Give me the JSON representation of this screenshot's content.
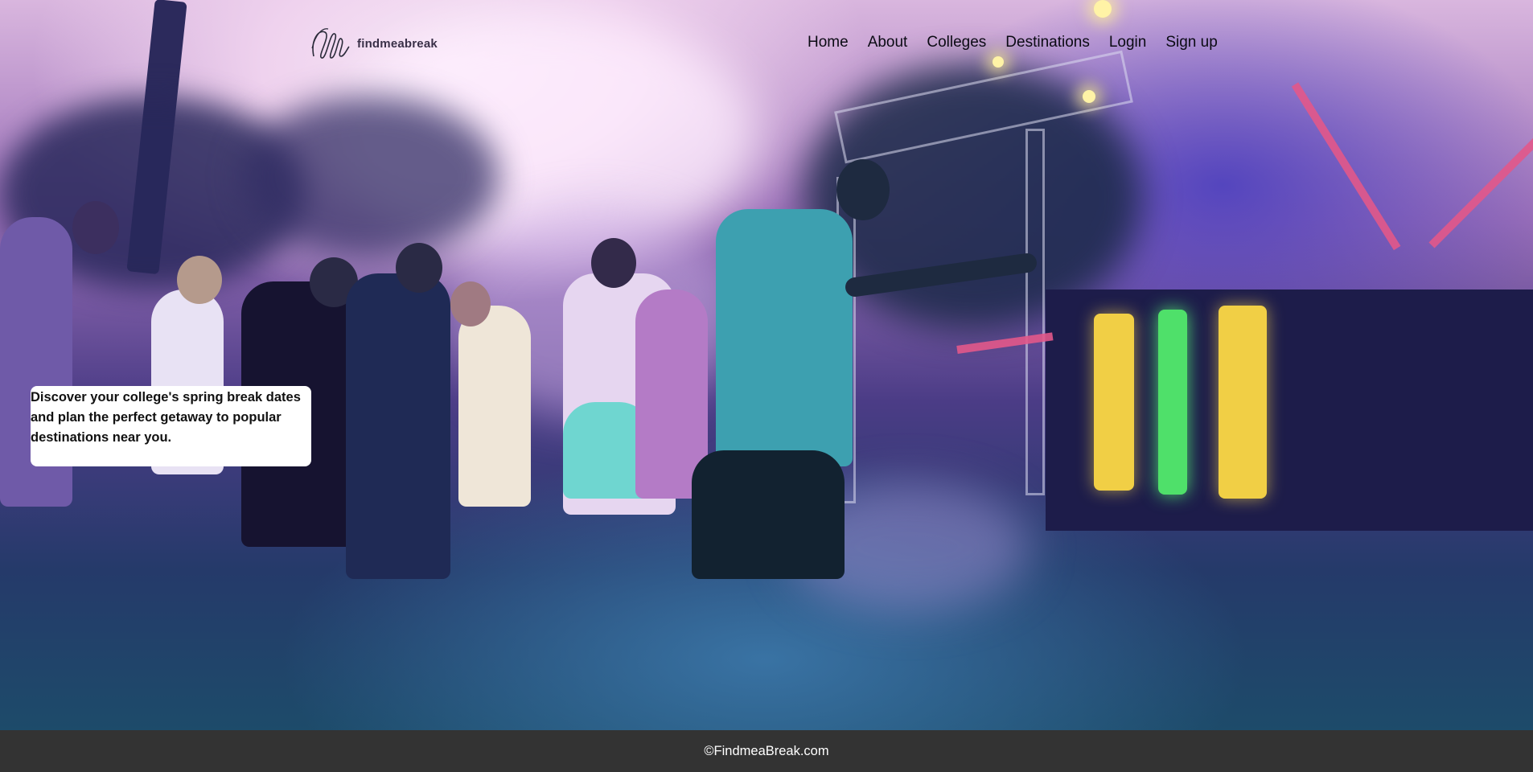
{
  "brand": {
    "name": "findmeabreak",
    "logo_icon": "scribble-logo-icon"
  },
  "nav": {
    "items": [
      {
        "label": "Home"
      },
      {
        "label": "About"
      },
      {
        "label": "Colleges"
      },
      {
        "label": "Destinations"
      },
      {
        "label": "Login"
      },
      {
        "label": "Sign up"
      }
    ]
  },
  "hero": {
    "tagline": "Discover your college's spring break dates and plan the perfect getaway to popular destinations near you.",
    "image_description_icon": "party-photo-background"
  },
  "footer": {
    "copyright": "©FindmeaBreak.com"
  },
  "colors": {
    "footer_bg": "#333333",
    "tagline_bg": "#ffffff",
    "nav_text": "#0b0b14"
  }
}
